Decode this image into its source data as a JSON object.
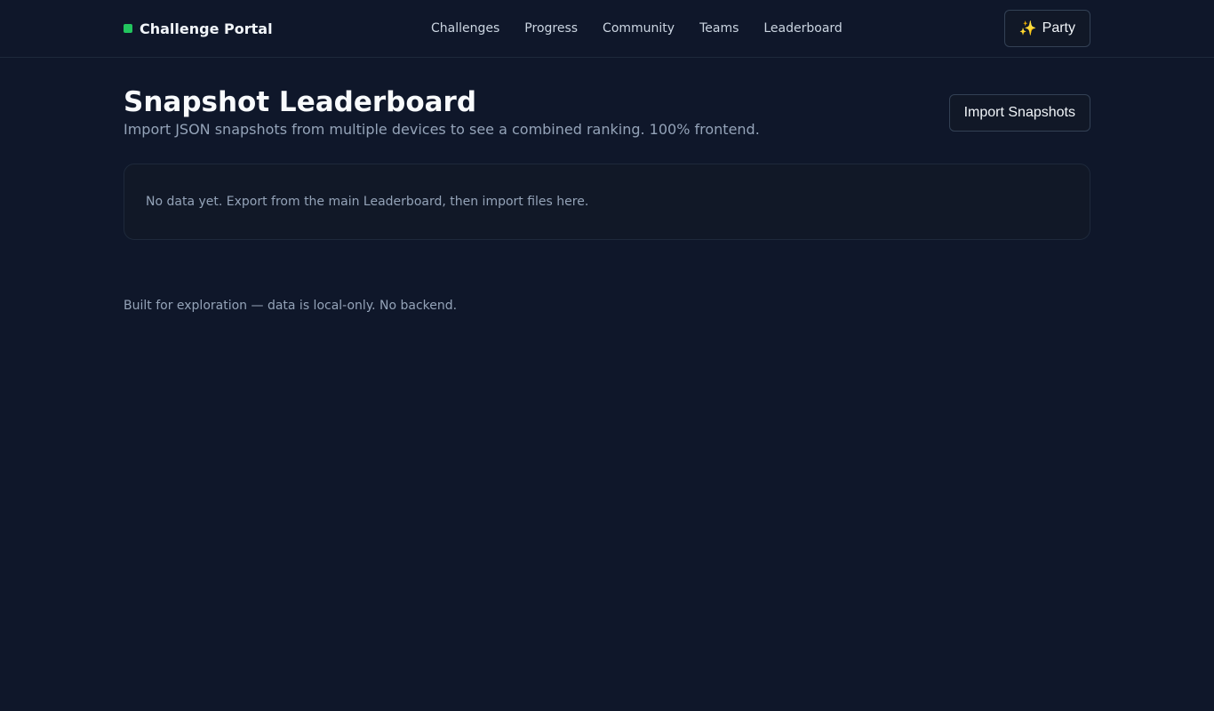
{
  "brand": {
    "name": "Challenge Portal",
    "accent_color": "#22c55e"
  },
  "nav": {
    "items": [
      {
        "label": "Challenges"
      },
      {
        "label": "Progress"
      },
      {
        "label": "Community"
      },
      {
        "label": "Teams"
      },
      {
        "label": "Leaderboard"
      }
    ]
  },
  "party_button": {
    "icon": "sparkles-icon",
    "icon_glyph": "✨",
    "label": "Party"
  },
  "page": {
    "title": "Snapshot Leaderboard",
    "subtitle": "Import JSON snapshots from multiple devices to see a combined ranking. 100% frontend.",
    "import_button": "Import Snapshots"
  },
  "empty_state": {
    "message": "No data yet. Export from the main Leaderboard, then import files here."
  },
  "footer": {
    "text": "Built for exploration — data is local-only. No backend."
  }
}
